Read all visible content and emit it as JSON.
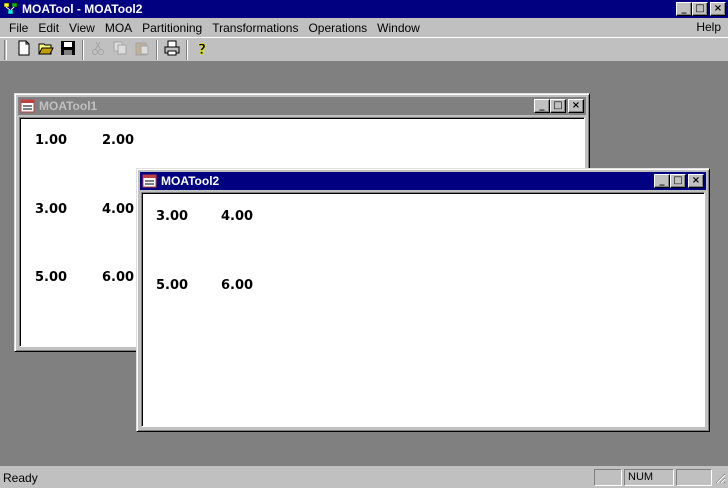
{
  "app": {
    "title": "MOATool - MOATool2",
    "icon": "network-app-icon"
  },
  "window_controls": {
    "minimize": "_",
    "maximize": "□",
    "close": "×"
  },
  "menu": {
    "file": "File",
    "edit": "Edit",
    "view": "View",
    "moa": "MOA",
    "partitioning": "Partitioning",
    "transformations": "Transformations",
    "operations": "Operations",
    "window": "Window",
    "help": "Help"
  },
  "toolbar": {
    "buttons": [
      "new-icon",
      "open-icon",
      "save-icon",
      "cut-icon",
      "copy-icon",
      "paste-icon",
      "print-icon",
      "about-icon"
    ]
  },
  "child1": {
    "title": "MOATool1",
    "values": [
      "1.00",
      "2.00",
      "3.00",
      "4.00",
      "5.00",
      "6.00"
    ]
  },
  "child2": {
    "title": "MOATool2",
    "values": [
      "3.00",
      "4.00",
      "5.00",
      "6.00"
    ]
  },
  "status": {
    "text": "Ready",
    "num": "NUM"
  },
  "colors": {
    "active_title": "#000080",
    "inactive_title": "#808080",
    "face": "#c0c0c0",
    "mdi_background": "#808080"
  }
}
